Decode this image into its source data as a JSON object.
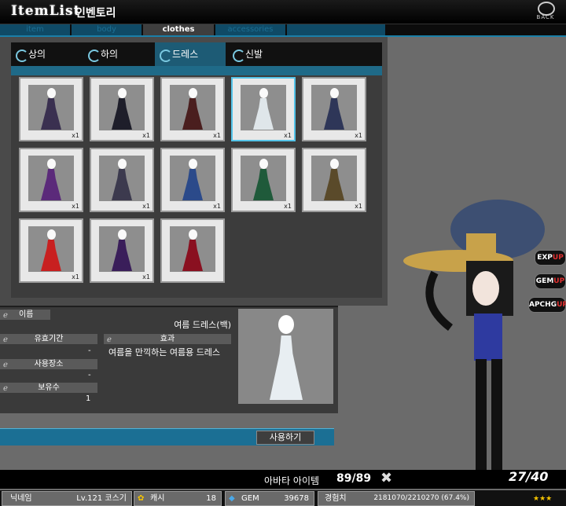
{
  "header": {
    "logo": "ItemList",
    "title": "인벤토리",
    "back_label": "BACK"
  },
  "tabs": [
    {
      "label": "item",
      "active": false
    },
    {
      "label": "body",
      "active": false
    },
    {
      "label": "clothes",
      "active": true
    },
    {
      "label": "accessories",
      "active": false
    }
  ],
  "categories": [
    {
      "label": "상의",
      "active": false
    },
    {
      "label": "하의",
      "active": false
    },
    {
      "label": "드레스",
      "active": true
    },
    {
      "label": "신발",
      "active": false
    }
  ],
  "items": [
    {
      "qty": "x1",
      "color": "#3a3050",
      "selected": false
    },
    {
      "qty": "x1",
      "color": "#1e1e2a",
      "selected": false
    },
    {
      "qty": "x1",
      "color": "#4a1e1e",
      "selected": false
    },
    {
      "qty": "x1",
      "color": "#dfe6ea",
      "selected": true
    },
    {
      "qty": "x1",
      "color": "#2e3658",
      "selected": false
    },
    {
      "qty": "x1",
      "color": "#5b2a7a",
      "selected": false
    },
    {
      "qty": "x1",
      "color": "#3c3a4e",
      "selected": false
    },
    {
      "qty": "x1",
      "color": "#2b4a8a",
      "selected": false
    },
    {
      "qty": "x1",
      "color": "#1f5a3a",
      "selected": false
    },
    {
      "qty": "x1",
      "color": "#5a4a2a",
      "selected": false
    },
    {
      "qty": "x1",
      "color": "#c82020",
      "selected": false
    },
    {
      "qty": "x1",
      "color": "#3a1e5a",
      "selected": false
    },
    {
      "qty": "",
      "color": "#8a1020",
      "selected": false
    }
  ],
  "info": {
    "name_label": "이름",
    "name_value": "여름 드레스(백)",
    "expiry_label": "유효기간",
    "expiry_value": "-",
    "effect_label": "효과",
    "effect_value": "여름을 만끽하는 여름용 드레스",
    "use_place_label": "사용장소",
    "use_place_value": "-",
    "owned_label": "보유수",
    "owned_value": "1"
  },
  "use_button": "사용하기",
  "side_buttons": [
    {
      "main": "EXP",
      "up": "UP"
    },
    {
      "main": "GEM",
      "up": "UP"
    },
    {
      "main": "APCHG",
      "up": "UP"
    }
  ],
  "avatar": {
    "label": "아바타 아이템",
    "count": "89/89"
  },
  "page_indicator": "27/40",
  "status": {
    "nickname_label": "닉네임",
    "level_name": "Lv.121 코스기",
    "cash_label": "캐시",
    "cash_value": "18",
    "gem_label": "GEM",
    "gem_value": "39678",
    "exp_label": "경험치",
    "exp_value": "2181070/2210270 (67.4%)"
  },
  "colors": {
    "accent": "#1b6f94",
    "highlight": "#54c3e8"
  }
}
